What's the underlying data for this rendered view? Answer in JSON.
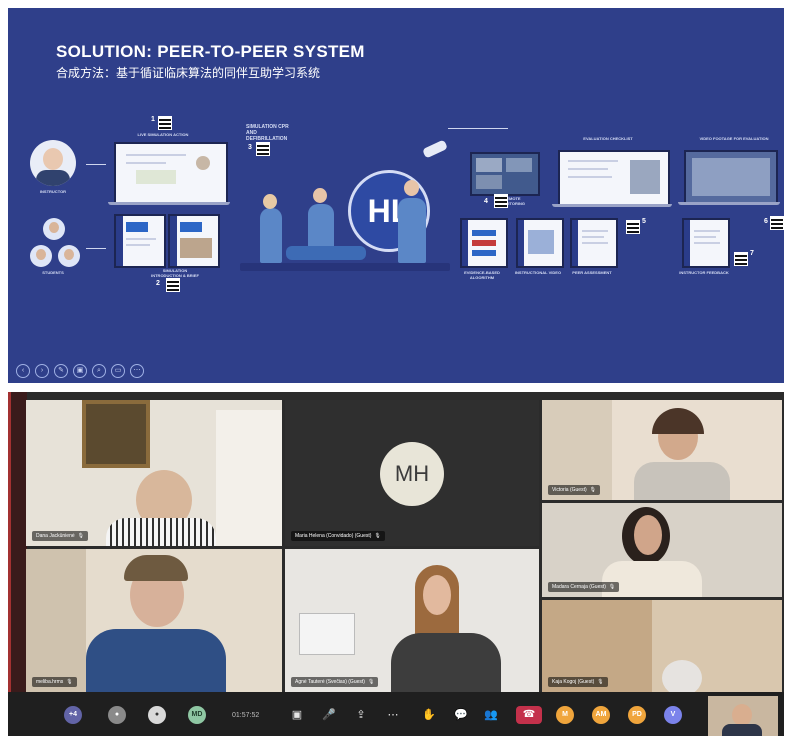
{
  "slide": {
    "title": "SOLUTION: PEER-TO-PEER SYSTEM",
    "subtitle": "合成方法：基于循证临床算法的同伴互助学习系统",
    "labels": {
      "instructor": "INSTRUCTOR",
      "students": "STUDENTS",
      "live_simulation": "LIVE SIMULATION ACTION",
      "simulation_intro": "SIMULATION INTRODUCTION & BRIEF",
      "simulation_cpr": "SIMULATION CPR AND DEFIBRILLATION",
      "remote_monitoring": "REMOTE MONITORING",
      "evaluation_checklist": "EVALUATION CHECKLIST",
      "video_footage": "VIDEO FOOTAGE FOR EVALUATION",
      "evidence_algorithm": "EVIDENCE-BASED ALGORITHM",
      "instructional_video": "INSTRUCTIONAL VIDEO",
      "peer_assessment": "PEER ASSESSMENT",
      "instructor_feedback": "INSTRUCTOR FEEDBACK"
    },
    "numbers": [
      "1",
      "2",
      "3",
      "4",
      "5",
      "6",
      "7"
    ],
    "logo": "HL",
    "nav_icons": [
      "prev-icon",
      "next-icon",
      "pen-icon",
      "slides-icon",
      "zoom-icon",
      "subtitles-icon",
      "more-icon"
    ]
  },
  "meeting": {
    "participants": [
      {
        "name": "Dana Jackūnienė"
      },
      {
        "name": "Maria Helena (Convidado) (Guest)",
        "initials": "MH"
      },
      {
        "name": "Victoria (Guest)"
      },
      {
        "name": "Madara Cernaja (Guest)"
      },
      {
        "name": "meliba.hrms"
      },
      {
        "name": "Agnė Tauterė (Svečias) (Guest)"
      },
      {
        "name": "Kaja Kogoj (Guest)"
      }
    ],
    "toolbar": {
      "more_count": "+4",
      "initials_md": "MD",
      "timer": "01:57:52",
      "right_avatars": [
        "M",
        "AM",
        "PD",
        "V"
      ]
    },
    "colors": {
      "slide_bg": "#2f3f8a",
      "avatar_purple": "#6264a7",
      "avatar_orange": "#f0a53c",
      "hangup_red": "#c4314b"
    }
  }
}
